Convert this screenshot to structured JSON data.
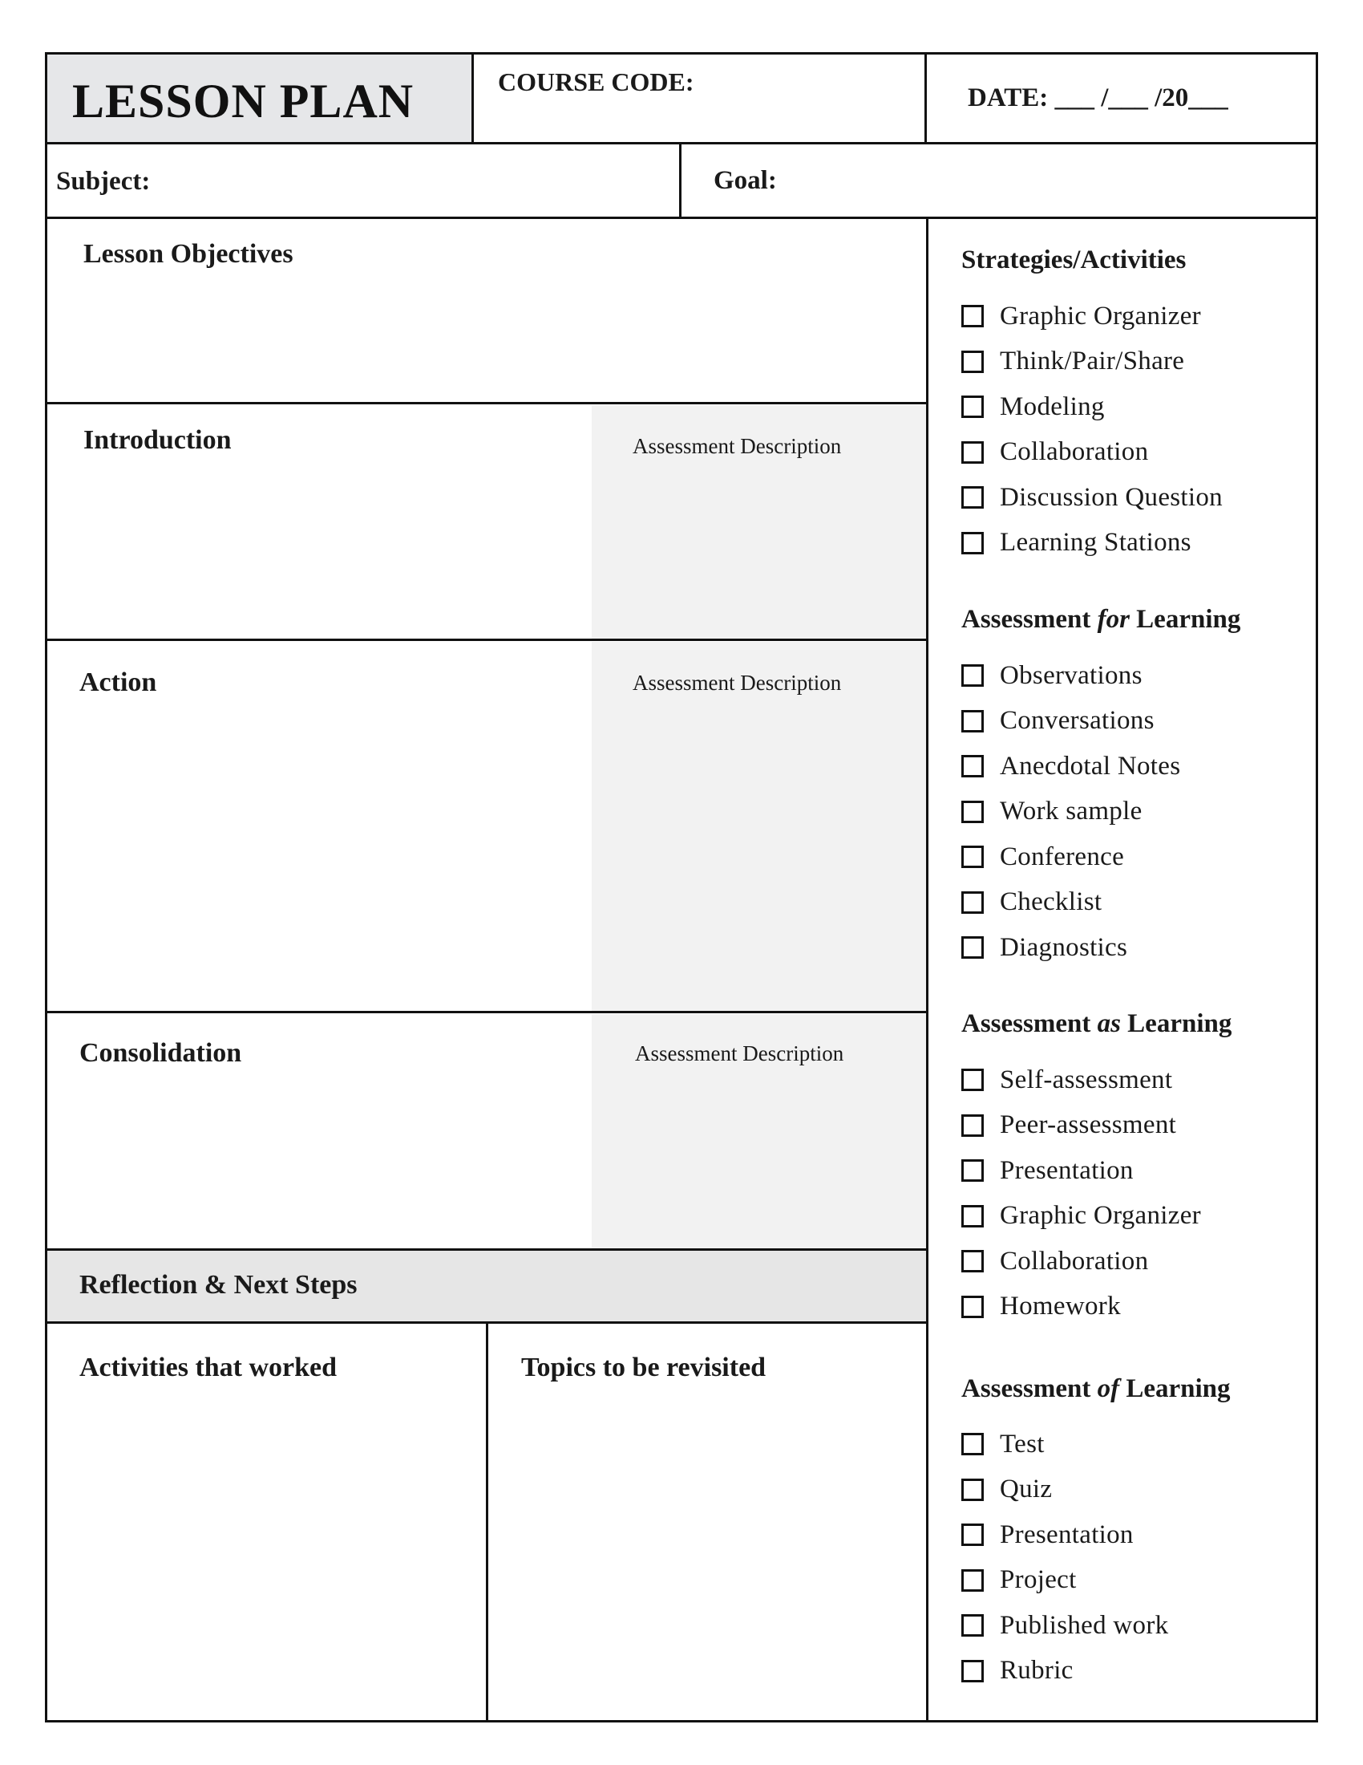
{
  "header": {
    "title": "LESSON PLAN",
    "course_code_label": "COURSE CODE:",
    "date_label": "DATE: ___ /___ /20___",
    "subject_label": "Subject:",
    "goal_label": "Goal:"
  },
  "sections": {
    "objectives": "Lesson Objectives",
    "introduction": "Introduction",
    "action": "Action",
    "consolidation": "Consolidation",
    "assessment_description": "Assessment Description",
    "reflection": "Reflection & Next Steps",
    "activities_worked": "Activities that worked",
    "topics_revisited": "Topics to be revisited"
  },
  "sidebar": {
    "groups": [
      {
        "heading_pre": "Strategies/Activities",
        "heading_em": "",
        "heading_post": "",
        "items": [
          "Graphic Organizer",
          "Think/Pair/Share",
          "Modeling",
          "Collaboration",
          "Discussion Question",
          "Learning Stations"
        ]
      },
      {
        "heading_pre": "Assessment ",
        "heading_em": "for",
        "heading_post": " Learning",
        "items": [
          "Observations",
          "Conversations",
          "Anecdotal Notes",
          "Work sample",
          "Conference",
          "Checklist",
          "Diagnostics"
        ]
      },
      {
        "heading_pre": "Assessment ",
        "heading_em": "as",
        "heading_post": " Learning",
        "items": [
          "Self-assessment",
          "Peer-assessment",
          "Presentation",
          "Graphic Organizer",
          "Collaboration",
          "Homework"
        ]
      },
      {
        "heading_pre": "Assessment ",
        "heading_em": "of",
        "heading_post": " Learning",
        "items": [
          "Test",
          "Quiz",
          "Presentation",
          "Project",
          "Published work",
          "Rubric"
        ]
      }
    ]
  },
  "colors": {
    "title_fill": "#e6e7e9",
    "assessment_fill": "#f2f2f2",
    "reflection_fill": "#e6e6e6",
    "border": "#111111"
  }
}
